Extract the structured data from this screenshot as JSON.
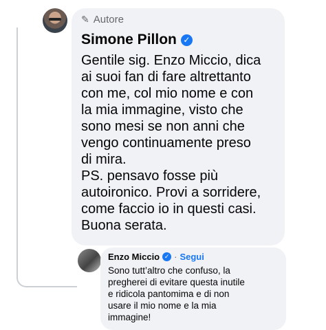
{
  "main_comment": {
    "author_badge": "Autore",
    "author_name": "Simone Pillon",
    "text": "Gentile sig. Enzo Miccio, dica\nai suoi fan di fare altrettanto\ncon me, col mio nome e con\nla mia immagine, visto che\nsono mesi se non anni che\nvengo continuamente preso\ndi mira.\nPS. pensavo fosse più\nautoironico. Provi a sorridere,\ncome faccio io in questi casi.\nBuona serata."
  },
  "reply_comment": {
    "author_name": "Enzo Miccio",
    "separator": "·",
    "follow_label": "Segui",
    "text": "Sono tutt’altro che confuso, la\npregherei di evitare questa inutile\ne ridicola pantomima e di non\nusare il mio nome e la mia\nimmagine!"
  },
  "icons": {
    "author_badge_icon": "pencil-icon",
    "verified_icon": "verified-badge-icon"
  },
  "colors": {
    "bubble_bg": "#f0f2f5",
    "accent": "#1877f2",
    "secondary_text": "#65676b"
  }
}
